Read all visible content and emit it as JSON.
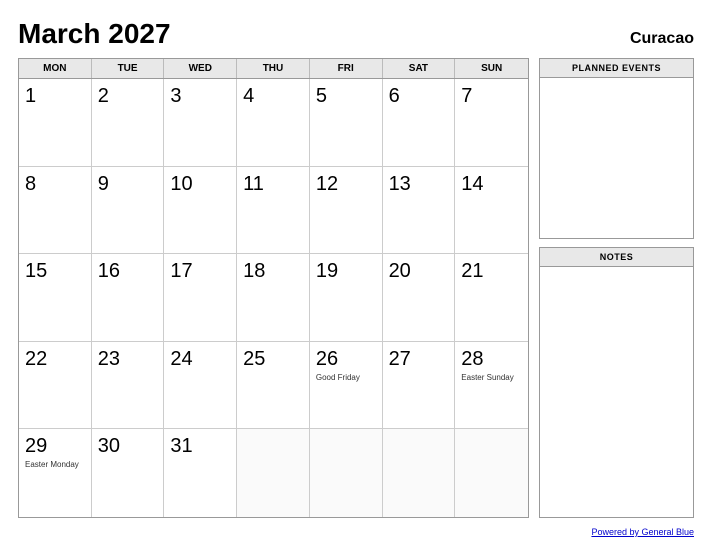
{
  "header": {
    "month_year": "March 2027",
    "region": "Curacao"
  },
  "day_headers": [
    "MON",
    "TUE",
    "WED",
    "THU",
    "FRI",
    "SAT",
    "SUN"
  ],
  "weeks": [
    [
      {
        "day": "1",
        "event": ""
      },
      {
        "day": "2",
        "event": ""
      },
      {
        "day": "3",
        "event": ""
      },
      {
        "day": "4",
        "event": ""
      },
      {
        "day": "5",
        "event": ""
      },
      {
        "day": "6",
        "event": ""
      },
      {
        "day": "7",
        "event": ""
      }
    ],
    [
      {
        "day": "8",
        "event": ""
      },
      {
        "day": "9",
        "event": ""
      },
      {
        "day": "10",
        "event": ""
      },
      {
        "day": "11",
        "event": ""
      },
      {
        "day": "12",
        "event": ""
      },
      {
        "day": "13",
        "event": ""
      },
      {
        "day": "14",
        "event": ""
      }
    ],
    [
      {
        "day": "15",
        "event": ""
      },
      {
        "day": "16",
        "event": ""
      },
      {
        "day": "17",
        "event": ""
      },
      {
        "day": "18",
        "event": ""
      },
      {
        "day": "19",
        "event": ""
      },
      {
        "day": "20",
        "event": ""
      },
      {
        "day": "21",
        "event": ""
      }
    ],
    [
      {
        "day": "22",
        "event": ""
      },
      {
        "day": "23",
        "event": ""
      },
      {
        "day": "24",
        "event": ""
      },
      {
        "day": "25",
        "event": ""
      },
      {
        "day": "26",
        "event": "Good Friday"
      },
      {
        "day": "27",
        "event": ""
      },
      {
        "day": "28",
        "event": "Easter Sunday"
      }
    ],
    [
      {
        "day": "29",
        "event": "Easter Monday"
      },
      {
        "day": "30",
        "event": ""
      },
      {
        "day": "31",
        "event": ""
      },
      {
        "day": "",
        "event": ""
      },
      {
        "day": "",
        "event": ""
      },
      {
        "day": "",
        "event": ""
      },
      {
        "day": "",
        "event": ""
      }
    ]
  ],
  "sidebar": {
    "planned_events_label": "PLANNED EVENTS",
    "notes_label": "NOTES"
  },
  "footer": {
    "link_text": "Powered by General Blue"
  }
}
